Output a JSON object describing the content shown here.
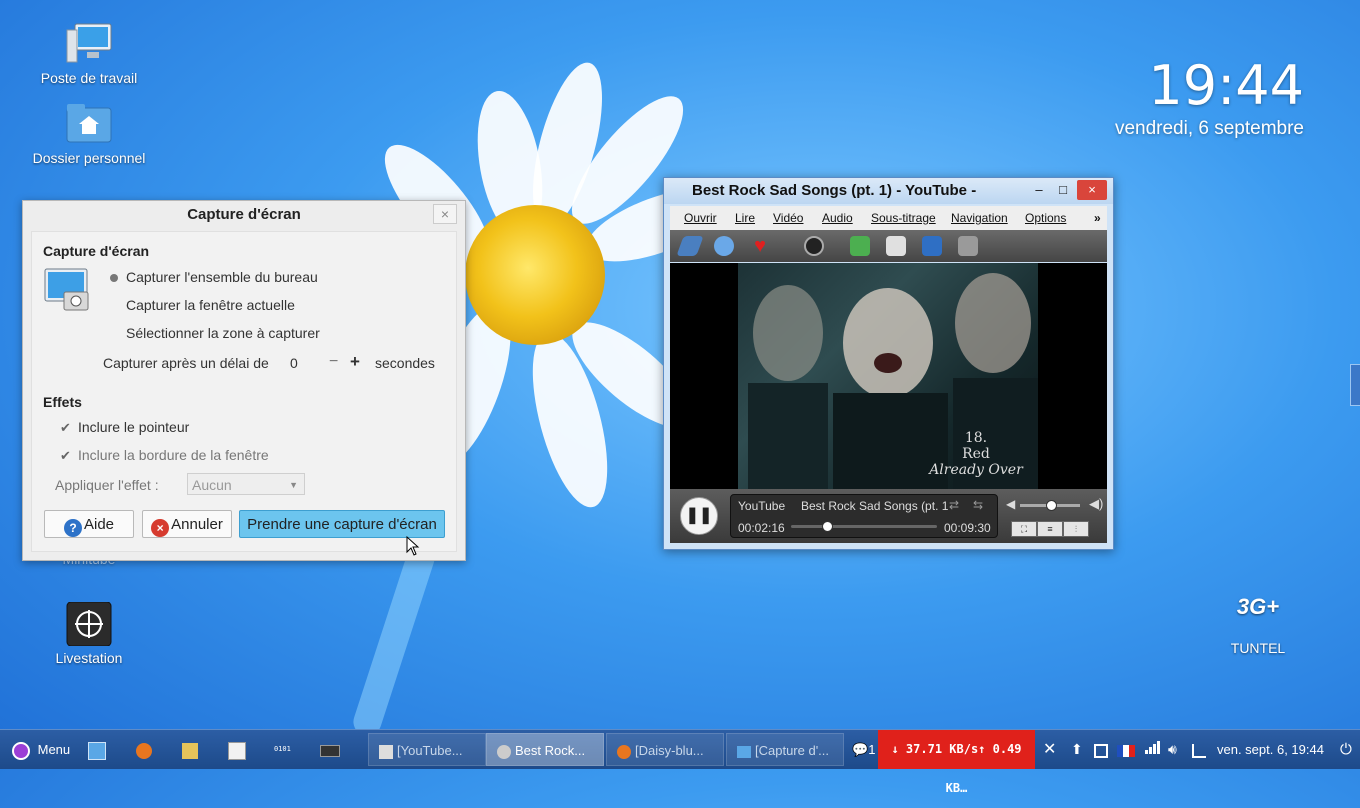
{
  "desktop": {
    "icons": [
      {
        "label": "Poste de travail"
      },
      {
        "label": "Dossier personnel"
      },
      {
        "label": "Minitube"
      },
      {
        "label": "Livestation"
      },
      {
        "label": "TUNTEL"
      }
    ],
    "clock": {
      "time": "19:44",
      "date": "vendredi, 6 septembre"
    },
    "tuntel_logo_text": "3G+"
  },
  "screenshot_dialog": {
    "window_title": "Capture d'écran",
    "close_glyph": "×",
    "section_capture": "Capture d'écran",
    "options": [
      {
        "label": "Capturer l'ensemble du bureau",
        "selected": true
      },
      {
        "label": "Capturer la fenêtre actuelle",
        "selected": false
      },
      {
        "label": "Sélectionner la zone à capturer",
        "selected": false
      }
    ],
    "delay_label": "Capturer après un délai de",
    "delay_value": "0",
    "delay_minus": "−",
    "delay_plus": "+",
    "delay_unit": "secondes",
    "section_effects": "Effets",
    "include_pointer": "Inclure le pointeur",
    "include_border": "Inclure la bordure de la fenêtre",
    "apply_effect_label": "Appliquer l'effet :",
    "apply_effect_value": "Aucun",
    "help_button": "Aide",
    "cancel_button": "Annuler",
    "take_button": "Prendre une capture d'écran"
  },
  "media_player": {
    "title": "Best Rock Sad Songs (pt. 1) - YouTube -",
    "minimize": "–",
    "maximize": "□",
    "close": "×",
    "menu": [
      "Ouvrir",
      "Lire",
      "Vidéo",
      "Audio",
      "Sous-titrage",
      "Navigation",
      "Options"
    ],
    "menu_more": "»",
    "overlay": {
      "number": "18.",
      "band": "Red",
      "song": "Already Over"
    },
    "source": "YouTube",
    "track": "Best Rock Sad Songs (pt. 1",
    "elapsed": "00:02:16",
    "duration": "00:09:30",
    "progress_fraction": 0.24,
    "volume_fraction": 0.5
  },
  "taskbar": {
    "menu_label": "Menu",
    "tasks": [
      {
        "label": "[YouTube...",
        "active": false
      },
      {
        "label": "Best Rock...",
        "active": true
      },
      {
        "label": "[Daisy-blu...",
        "active": false
      },
      {
        "label": "[Capture d'...",
        "active": false
      }
    ],
    "notif_count": "1",
    "net_speed": "↓ 37.71 KB/s↑ 0.49 KB…",
    "datetime": "ven. sept. 6, 19:44"
  }
}
